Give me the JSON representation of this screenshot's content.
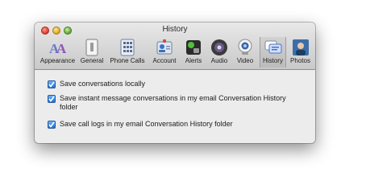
{
  "window": {
    "title": "History"
  },
  "toolbar": {
    "tabs": [
      {
        "label": "Appearance",
        "icon": "appearance-icon",
        "active": false
      },
      {
        "label": "General",
        "icon": "general-switch-icon",
        "active": false
      },
      {
        "label": "Phone Calls",
        "icon": "phone-keypad-icon",
        "active": false
      },
      {
        "label": "Account",
        "icon": "account-card-icon",
        "active": false
      },
      {
        "label": "Alerts",
        "icon": "alerts-icon",
        "active": false
      },
      {
        "label": "Audio",
        "icon": "speaker-icon",
        "active": false
      },
      {
        "label": "Video",
        "icon": "webcam-icon",
        "active": false
      },
      {
        "label": "History",
        "icon": "history-bubble-icon",
        "active": true
      },
      {
        "label": "Photos",
        "icon": "photos-icon",
        "active": false
      }
    ]
  },
  "history": {
    "options": [
      {
        "label": "Save conversations locally",
        "checked": true
      },
      {
        "label": "Save instant message conversations in my email Conversation History folder",
        "checked": true
      },
      {
        "label": "Save call logs in my email Conversation History folder",
        "checked": true
      }
    ]
  },
  "colors": {
    "checkbox_accent": "#2a7ce0",
    "window_bg": "#ececec"
  }
}
